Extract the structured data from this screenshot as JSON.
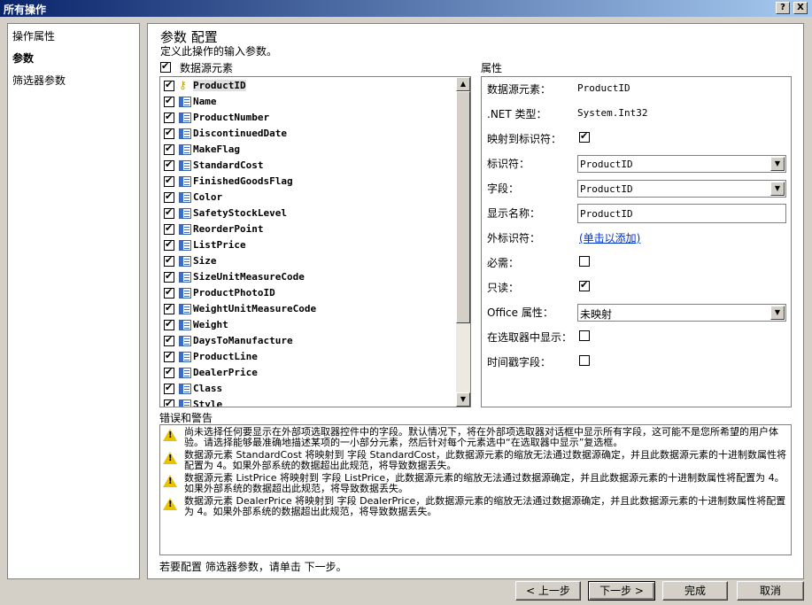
{
  "window": {
    "title": "所有操作",
    "help_label": "?",
    "close_label": "X"
  },
  "nav": {
    "items": [
      {
        "label": "操作属性"
      },
      {
        "label": "参数"
      },
      {
        "label": "筛选器参数"
      }
    ]
  },
  "main": {
    "heading": "参数 配置",
    "subheading": "定义此操作的输入参数。",
    "datasource_label": "数据源元素",
    "properties_label": "属性",
    "errors_label": "错误和警告",
    "footer_hint": "若要配置 筛选器参数，请单击 下一步。"
  },
  "fields": [
    {
      "name": "ProductID",
      "key": true
    },
    {
      "name": "Name"
    },
    {
      "name": "ProductNumber"
    },
    {
      "name": "DiscontinuedDate"
    },
    {
      "name": "MakeFlag"
    },
    {
      "name": "StandardCost"
    },
    {
      "name": "FinishedGoodsFlag"
    },
    {
      "name": "Color"
    },
    {
      "name": "SafetyStockLevel"
    },
    {
      "name": "ReorderPoint"
    },
    {
      "name": "ListPrice"
    },
    {
      "name": "Size"
    },
    {
      "name": "SizeUnitMeasureCode"
    },
    {
      "name": "ProductPhotoID"
    },
    {
      "name": "WeightUnitMeasureCode"
    },
    {
      "name": "Weight"
    },
    {
      "name": "DaysToManufacture"
    },
    {
      "name": "ProductLine"
    },
    {
      "name": "DealerPrice"
    },
    {
      "name": "Class"
    },
    {
      "name": "Style"
    }
  ],
  "props": {
    "ds_element_label": "数据源元素：",
    "ds_element_value": "ProductID",
    "net_type_label": ".NET 类型：",
    "net_type_value": "System.Int32",
    "map_id_label": "映射到标识符：",
    "identifier_label": "标识符：",
    "identifier_value": "ProductID",
    "field_label": "字段：",
    "field_value": "ProductID",
    "display_name_label": "显示名称：",
    "display_name_value": "ProductID",
    "foreign_id_label": "外标识符：",
    "foreign_id_link": "(单击以添加)",
    "required_label": "必需：",
    "readonly_label": "只读：",
    "office_prop_label": "Office 属性：",
    "office_prop_value": "未映射",
    "show_in_picker_label": "在选取器中显示：",
    "timestamp_label": "时间戳字段："
  },
  "warnings": [
    "尚未选择任何要显示在外部项选取器控件中的字段。默认情况下，将在外部项选取器对话框中显示所有字段，这可能不是您所希望的用户体验。请选择能够最准确地描述某项的一小部分元素，然后针对每个元素选中“在选取器中显示”复选框。",
    "数据源元素 StandardCost 将映射到 字段 StandardCost，此数据源元素的缩放无法通过数据源确定，并且此数据源元素的十进制数属性将配置为 4。如果外部系统的数据超出此规范，将导致数据丢失。",
    "数据源元素 ListPrice 将映射到 字段 ListPrice，此数据源元素的缩放无法通过数据源确定，并且此数据源元素的十进制数属性将配置为 4。如果外部系统的数据超出此规范，将导致数据丢失。",
    "数据源元素 DealerPrice 将映射到 字段 DealerPrice，此数据源元素的缩放无法通过数据源确定，并且此数据源元素的十进制数属性将配置为 4。如果外部系统的数据超出此规范，将导致数据丢失。"
  ],
  "buttons": {
    "back": "< 上一步",
    "next": "下一步 >",
    "finish": "完成",
    "cancel": "取消"
  }
}
